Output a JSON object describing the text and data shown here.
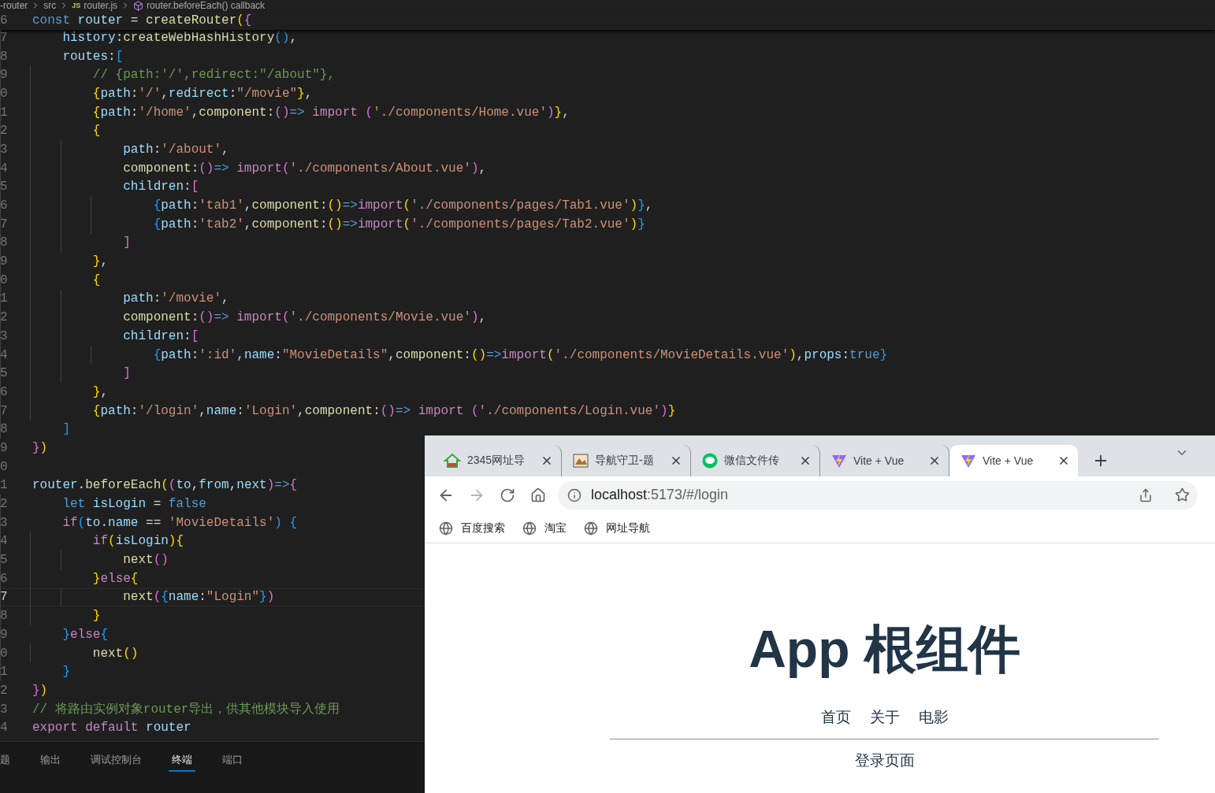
{
  "breadcrumb": [
    {
      "kind": "folder",
      "text": "-router"
    },
    {
      "kind": "folder",
      "text": "src"
    },
    {
      "kind": "file",
      "badge": "JS",
      "text": "router.js"
    },
    {
      "kind": "symbol",
      "text": "router.beforeEach() callback"
    }
  ],
  "sticky_line": {
    "number": "6",
    "tokens": [
      {
        "kind": "kw",
        "text": "const "
      },
      {
        "kind": "var",
        "text": "router"
      },
      {
        "kind": "p",
        "text": " = "
      },
      {
        "kind": "fn",
        "text": "createRouter"
      },
      {
        "kind": "b1",
        "text": "("
      },
      {
        "kind": "b2",
        "text": "{"
      }
    ]
  },
  "lines": [
    {
      "number": "7",
      "current": false,
      "tokens": [
        {
          "kind": "var",
          "text": "    history"
        },
        {
          "kind": "p",
          "text": ":"
        },
        {
          "kind": "fn",
          "text": "createWebHashHistory"
        },
        {
          "kind": "b3",
          "text": "()"
        },
        {
          "kind": "p",
          "text": ","
        }
      ]
    },
    {
      "number": "8",
      "current": false,
      "tokens": [
        {
          "kind": "var",
          "text": "    routes"
        },
        {
          "kind": "p",
          "text": ":"
        },
        {
          "kind": "b3",
          "text": "["
        }
      ]
    },
    {
      "number": "9",
      "current": false,
      "tokens": [
        {
          "kind": "cmt",
          "text": "        // {path:'/',redirect:\"/about\"},"
        }
      ]
    },
    {
      "number": "0",
      "current": false,
      "tokens": [
        {
          "kind": "b1",
          "text": "        {"
        },
        {
          "kind": "var",
          "text": "path"
        },
        {
          "kind": "p",
          "text": ":"
        },
        {
          "kind": "str",
          "text": "'/'"
        },
        {
          "kind": "p",
          "text": ","
        },
        {
          "kind": "var",
          "text": "redirect"
        },
        {
          "kind": "p",
          "text": ":"
        },
        {
          "kind": "str",
          "text": "\"/movie\""
        },
        {
          "kind": "b1",
          "text": "}"
        },
        {
          "kind": "p",
          "text": ","
        }
      ]
    },
    {
      "number": "1",
      "current": false,
      "tokens": [
        {
          "kind": "b1",
          "text": "        {"
        },
        {
          "kind": "var",
          "text": "path"
        },
        {
          "kind": "p",
          "text": ":"
        },
        {
          "kind": "str",
          "text": "'/home'"
        },
        {
          "kind": "p",
          "text": ","
        },
        {
          "kind": "fn",
          "text": "component"
        },
        {
          "kind": "p",
          "text": ":"
        },
        {
          "kind": "b2",
          "text": "()"
        },
        {
          "kind": "kw",
          "text": "=> "
        },
        {
          "kind": "ctrl",
          "text": "import "
        },
        {
          "kind": "b2",
          "text": "("
        },
        {
          "kind": "str",
          "text": "'./components/Home.vue'"
        },
        {
          "kind": "b2",
          "text": ")"
        },
        {
          "kind": "b1",
          "text": "}"
        },
        {
          "kind": "p",
          "text": ","
        }
      ]
    },
    {
      "number": "2",
      "current": false,
      "tokens": [
        {
          "kind": "b1",
          "text": "        {"
        }
      ]
    },
    {
      "number": "3",
      "current": false,
      "tokens": [
        {
          "kind": "var",
          "text": "            path"
        },
        {
          "kind": "p",
          "text": ":"
        },
        {
          "kind": "str",
          "text": "'/about'"
        },
        {
          "kind": "p",
          "text": ","
        }
      ]
    },
    {
      "number": "4",
      "current": false,
      "tokens": [
        {
          "kind": "fn",
          "text": "            component"
        },
        {
          "kind": "p",
          "text": ":"
        },
        {
          "kind": "b2",
          "text": "()"
        },
        {
          "kind": "kw",
          "text": "=> "
        },
        {
          "kind": "ctrl",
          "text": "import"
        },
        {
          "kind": "b2",
          "text": "("
        },
        {
          "kind": "str",
          "text": "'./components/About.vue'"
        },
        {
          "kind": "b2",
          "text": ")"
        },
        {
          "kind": "p",
          "text": ","
        }
      ]
    },
    {
      "number": "5",
      "current": false,
      "tokens": [
        {
          "kind": "var",
          "text": "            children"
        },
        {
          "kind": "p",
          "text": ":"
        },
        {
          "kind": "b2",
          "text": "["
        }
      ]
    },
    {
      "number": "6",
      "current": false,
      "tokens": [
        {
          "kind": "b3",
          "text": "                {"
        },
        {
          "kind": "var",
          "text": "path"
        },
        {
          "kind": "p",
          "text": ":"
        },
        {
          "kind": "str",
          "text": "'tab1'"
        },
        {
          "kind": "p",
          "text": ","
        },
        {
          "kind": "fn",
          "text": "component"
        },
        {
          "kind": "p",
          "text": ":"
        },
        {
          "kind": "b1",
          "text": "()"
        },
        {
          "kind": "kw",
          "text": "=>"
        },
        {
          "kind": "ctrl",
          "text": "import"
        },
        {
          "kind": "b1",
          "text": "("
        },
        {
          "kind": "str",
          "text": "'./components/pages/Tab1.vue'"
        },
        {
          "kind": "b1",
          "text": ")"
        },
        {
          "kind": "b3",
          "text": "}"
        },
        {
          "kind": "p",
          "text": ","
        }
      ]
    },
    {
      "number": "7",
      "current": false,
      "tokens": [
        {
          "kind": "b3",
          "text": "                {"
        },
        {
          "kind": "var",
          "text": "path"
        },
        {
          "kind": "p",
          "text": ":"
        },
        {
          "kind": "str",
          "text": "'tab2'"
        },
        {
          "kind": "p",
          "text": ","
        },
        {
          "kind": "fn",
          "text": "component"
        },
        {
          "kind": "p",
          "text": ":"
        },
        {
          "kind": "b1",
          "text": "()"
        },
        {
          "kind": "kw",
          "text": "=>"
        },
        {
          "kind": "ctrl",
          "text": "import"
        },
        {
          "kind": "b1",
          "text": "("
        },
        {
          "kind": "str",
          "text": "'./components/pages/Tab2.vue'"
        },
        {
          "kind": "b1",
          "text": ")"
        },
        {
          "kind": "b3",
          "text": "}"
        }
      ]
    },
    {
      "number": "8",
      "current": false,
      "tokens": [
        {
          "kind": "b2",
          "text": "            ]"
        }
      ]
    },
    {
      "number": "9",
      "current": false,
      "tokens": [
        {
          "kind": "b1",
          "text": "        }"
        },
        {
          "kind": "p",
          "text": ","
        }
      ]
    },
    {
      "number": "0",
      "current": false,
      "tokens": [
        {
          "kind": "b1",
          "text": "        {"
        }
      ]
    },
    {
      "number": "1",
      "current": false,
      "tokens": [
        {
          "kind": "var",
          "text": "            path"
        },
        {
          "kind": "p",
          "text": ":"
        },
        {
          "kind": "str",
          "text": "'/movie'"
        },
        {
          "kind": "p",
          "text": ","
        }
      ]
    },
    {
      "number": "2",
      "current": false,
      "tokens": [
        {
          "kind": "fn",
          "text": "            component"
        },
        {
          "kind": "p",
          "text": ":"
        },
        {
          "kind": "b2",
          "text": "()"
        },
        {
          "kind": "kw",
          "text": "=> "
        },
        {
          "kind": "ctrl",
          "text": "import"
        },
        {
          "kind": "b2",
          "text": "("
        },
        {
          "kind": "str",
          "text": "'./components/Movie.vue'"
        },
        {
          "kind": "b2",
          "text": ")"
        },
        {
          "kind": "p",
          "text": ","
        }
      ]
    },
    {
      "number": "3",
      "current": false,
      "tokens": [
        {
          "kind": "var",
          "text": "            children"
        },
        {
          "kind": "p",
          "text": ":"
        },
        {
          "kind": "b2",
          "text": "["
        }
      ]
    },
    {
      "number": "4",
      "current": false,
      "tokens": [
        {
          "kind": "b3",
          "text": "                {"
        },
        {
          "kind": "var",
          "text": "path"
        },
        {
          "kind": "p",
          "text": ":"
        },
        {
          "kind": "str",
          "text": "':id'"
        },
        {
          "kind": "p",
          "text": ","
        },
        {
          "kind": "var",
          "text": "name"
        },
        {
          "kind": "p",
          "text": ":"
        },
        {
          "kind": "str",
          "text": "\"MovieDetails\""
        },
        {
          "kind": "p",
          "text": ","
        },
        {
          "kind": "fn",
          "text": "component"
        },
        {
          "kind": "p",
          "text": ":"
        },
        {
          "kind": "b1",
          "text": "()"
        },
        {
          "kind": "kw",
          "text": "=>"
        },
        {
          "kind": "ctrl",
          "text": "import"
        },
        {
          "kind": "b1",
          "text": "("
        },
        {
          "kind": "str",
          "text": "'./components/MovieDetails.vue'"
        },
        {
          "kind": "b1",
          "text": ")"
        },
        {
          "kind": "p",
          "text": ","
        },
        {
          "kind": "var",
          "text": "props"
        },
        {
          "kind": "p",
          "text": ":"
        },
        {
          "kind": "kw",
          "text": "true"
        },
        {
          "kind": "b3",
          "text": "}"
        }
      ]
    },
    {
      "number": "5",
      "current": false,
      "tokens": [
        {
          "kind": "b2",
          "text": "            ]"
        }
      ]
    },
    {
      "number": "6",
      "current": false,
      "tokens": [
        {
          "kind": "b1",
          "text": "        }"
        },
        {
          "kind": "p",
          "text": ","
        }
      ]
    },
    {
      "number": "7",
      "current": false,
      "tokens": [
        {
          "kind": "b1",
          "text": "        {"
        },
        {
          "kind": "var",
          "text": "path"
        },
        {
          "kind": "p",
          "text": ":"
        },
        {
          "kind": "str",
          "text": "'/login'"
        },
        {
          "kind": "p",
          "text": ","
        },
        {
          "kind": "var",
          "text": "name"
        },
        {
          "kind": "p",
          "text": ":"
        },
        {
          "kind": "str",
          "text": "'Login'"
        },
        {
          "kind": "p",
          "text": ","
        },
        {
          "kind": "fn",
          "text": "component"
        },
        {
          "kind": "p",
          "text": ":"
        },
        {
          "kind": "b2",
          "text": "()"
        },
        {
          "kind": "kw",
          "text": "=> "
        },
        {
          "kind": "ctrl",
          "text": "import "
        },
        {
          "kind": "b2",
          "text": "("
        },
        {
          "kind": "str",
          "text": "'./components/Login.vue'"
        },
        {
          "kind": "b2",
          "text": ")"
        },
        {
          "kind": "b1",
          "text": "}"
        }
      ]
    },
    {
      "number": "8",
      "current": false,
      "tokens": [
        {
          "kind": "b3",
          "text": "    ]"
        }
      ]
    },
    {
      "number": "9",
      "current": false,
      "tokens": [
        {
          "kind": "b2",
          "text": "}"
        },
        {
          "kind": "b1",
          "text": ")"
        }
      ]
    },
    {
      "number": "0",
      "current": false
    },
    {
      "number": "1",
      "current": false,
      "tokens": [
        {
          "kind": "var",
          "text": "router"
        },
        {
          "kind": "p",
          "text": "."
        },
        {
          "kind": "fn",
          "text": "beforeEach"
        },
        {
          "kind": "b1",
          "text": "("
        },
        {
          "kind": "b2",
          "text": "("
        },
        {
          "kind": "var",
          "text": "to"
        },
        {
          "kind": "p",
          "text": ","
        },
        {
          "kind": "var",
          "text": "from"
        },
        {
          "kind": "p",
          "text": ","
        },
        {
          "kind": "var",
          "text": "next"
        },
        {
          "kind": "b2",
          "text": ")"
        },
        {
          "kind": "kw",
          "text": "=>"
        },
        {
          "kind": "b2",
          "text": "{"
        }
      ]
    },
    {
      "number": "2",
      "current": false,
      "tokens": [
        {
          "kind": "kw",
          "text": "    let "
        },
        {
          "kind": "var",
          "text": "isLogin"
        },
        {
          "kind": "p",
          "text": " = "
        },
        {
          "kind": "kw",
          "text": "false"
        }
      ]
    },
    {
      "number": "3",
      "current": false,
      "tokens": [
        {
          "kind": "ctrl",
          "text": "    if"
        },
        {
          "kind": "b3",
          "text": "("
        },
        {
          "kind": "var",
          "text": "to"
        },
        {
          "kind": "p",
          "text": "."
        },
        {
          "kind": "var",
          "text": "name"
        },
        {
          "kind": "p",
          "text": " == "
        },
        {
          "kind": "str",
          "text": "'MovieDetails'"
        },
        {
          "kind": "b3",
          "text": ") {"
        }
      ]
    },
    {
      "number": "4",
      "current": false,
      "tokens": [
        {
          "kind": "ctrl",
          "text": "        if"
        },
        {
          "kind": "b1",
          "text": "("
        },
        {
          "kind": "var",
          "text": "isLogin"
        },
        {
          "kind": "b1",
          "text": "){"
        }
      ]
    },
    {
      "number": "5",
      "current": false,
      "tokens": [
        {
          "kind": "fn",
          "text": "            next"
        },
        {
          "kind": "b2",
          "text": "()"
        }
      ]
    },
    {
      "number": "6",
      "current": false,
      "tokens": [
        {
          "kind": "b1",
          "text": "        }"
        },
        {
          "kind": "ctrl",
          "text": "else"
        },
        {
          "kind": "b1",
          "text": "{"
        }
      ]
    },
    {
      "number": "7",
      "current": true,
      "tokens": [
        {
          "kind": "fn",
          "text": "            next"
        },
        {
          "kind": "b2",
          "text": "("
        },
        {
          "kind": "b3",
          "text": "{"
        },
        {
          "kind": "var",
          "text": "name"
        },
        {
          "kind": "p",
          "text": ":"
        },
        {
          "kind": "str",
          "text": "\"Login\""
        },
        {
          "kind": "b3",
          "text": "}"
        },
        {
          "kind": "b2",
          "text": ")"
        }
      ]
    },
    {
      "number": "8",
      "current": false,
      "tokens": [
        {
          "kind": "b1",
          "text": "        }"
        }
      ]
    },
    {
      "number": "9",
      "current": false,
      "tokens": [
        {
          "kind": "b3",
          "text": "    }"
        },
        {
          "kind": "ctrl",
          "text": "else"
        },
        {
          "kind": "b3",
          "text": "{"
        }
      ]
    },
    {
      "number": "0",
      "current": false,
      "tokens": [
        {
          "kind": "fn",
          "text": "        next"
        },
        {
          "kind": "b1",
          "text": "()"
        }
      ]
    },
    {
      "number": "1",
      "current": false,
      "tokens": [
        {
          "kind": "b3",
          "text": "    }"
        }
      ]
    },
    {
      "number": "2",
      "current": false,
      "tokens": [
        {
          "kind": "b2",
          "text": "}"
        },
        {
          "kind": "b1",
          "text": ")"
        }
      ]
    },
    {
      "number": "3",
      "current": false,
      "tokens": [
        {
          "kind": "cmt",
          "text": "// 将路由实例对象router导出，供其他模块导入使用"
        }
      ]
    },
    {
      "number": "4",
      "current": false,
      "tokens": [
        {
          "kind": "ctrl",
          "text": "export default "
        },
        {
          "kind": "var",
          "text": "router"
        }
      ]
    }
  ],
  "panel_tabs": [
    {
      "label": "题",
      "selected": false
    },
    {
      "label": "输出",
      "selected": false
    },
    {
      "label": "调试控制台",
      "selected": false
    },
    {
      "label": "终端",
      "selected": true
    },
    {
      "label": "端口",
      "selected": false
    }
  ],
  "browser": {
    "tabs": [
      {
        "title": "2345网址导",
        "selected": false
      },
      {
        "title": "导航守卫-题",
        "selected": false
      },
      {
        "title": "微信文件传",
        "selected": false
      },
      {
        "title": "Vite + Vue",
        "selected": false
      },
      {
        "title": "Vite + Vue",
        "selected": true
      }
    ],
    "forward_disabled": true,
    "url_host": "localhost",
    "url_rest": ":5173/#/login",
    "bookmarks": [
      "百度搜索",
      "淘宝",
      "网址导航"
    ],
    "page": {
      "heading": "App 根组件",
      "nav": [
        "首页",
        "关于",
        "电影"
      ],
      "content": "登录页面"
    }
  }
}
